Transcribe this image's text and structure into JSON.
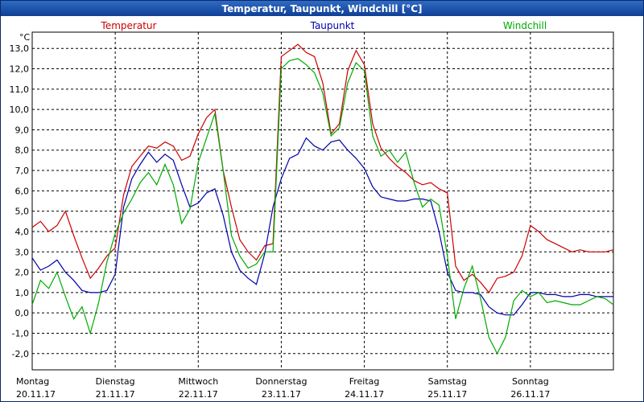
{
  "window": {
    "title": "Temperatur, Taupunkt, Windchill [°C]"
  },
  "chart_data": {
    "type": "line",
    "title": "Temperatur, Taupunkt, Windchill [°C]",
    "ylabel": "°C",
    "ylim": [
      -2.8,
      13.8
    ],
    "yticks": [
      -2,
      -1,
      0,
      1,
      2,
      3,
      4,
      5,
      6,
      7,
      8,
      9,
      10,
      11,
      12,
      13
    ],
    "ytick_labels": [
      "-2,0",
      "-1,0",
      "0,0",
      "1,0",
      "2,0",
      "3,0",
      "4,0",
      "5,0",
      "6,0",
      "7,0",
      "8,0",
      "9,0",
      "10,0",
      "11,0",
      "12,0",
      "13,0"
    ],
    "xlim": [
      0,
      7.0
    ],
    "grid": true,
    "x_label_days": [
      {
        "pos": 0,
        "day": "Montag",
        "date": "20.11.17"
      },
      {
        "pos": 1,
        "day": "Dienstag",
        "date": "21.11.17"
      },
      {
        "pos": 2,
        "day": "Mittwoch",
        "date": "22.11.17"
      },
      {
        "pos": 3,
        "day": "Donnerstag",
        "date": "23.11.17"
      },
      {
        "pos": 4,
        "day": "Freitag",
        "date": "24.11.17"
      },
      {
        "pos": 5,
        "day": "Samstag",
        "date": "25.11.17"
      },
      {
        "pos": 6,
        "day": "Sonntag",
        "date": "26.11.17"
      }
    ],
    "series": [
      {
        "name": "Temperatur",
        "color": "#cc0000",
        "x": [
          0,
          0.1,
          0.2,
          0.3,
          0.4,
          0.5,
          0.6,
          0.7,
          0.8,
          0.9,
          1.0,
          1.1,
          1.2,
          1.3,
          1.4,
          1.5,
          1.6,
          1.7,
          1.8,
          1.9,
          2.0,
          2.1,
          2.2,
          2.3,
          2.4,
          2.5,
          2.6,
          2.7,
          2.8,
          2.9,
          3.0,
          3.1,
          3.2,
          3.3,
          3.4,
          3.5,
          3.6,
          3.7,
          3.8,
          3.9,
          4.0,
          4.1,
          4.2,
          4.3,
          4.4,
          4.5,
          4.6,
          4.7,
          4.8,
          4.9,
          5.0,
          5.1,
          5.2,
          5.3,
          5.4,
          5.5,
          5.6,
          5.7,
          5.8,
          5.9,
          6.0,
          6.1,
          6.2,
          6.3,
          6.4,
          6.5,
          6.6,
          6.7,
          6.8,
          6.9,
          7.0
        ],
        "values": [
          4.2,
          4.5,
          4.0,
          4.3,
          5.0,
          3.8,
          2.7,
          1.7,
          2.2,
          2.8,
          3.2,
          5.8,
          7.2,
          7.7,
          8.2,
          8.1,
          8.4,
          8.2,
          7.5,
          7.7,
          8.8,
          9.6,
          10.0,
          7.0,
          5.2,
          3.6,
          3.0,
          2.6,
          3.3,
          3.4,
          12.6,
          12.9,
          13.2,
          12.8,
          12.6,
          11.3,
          8.8,
          9.3,
          11.9,
          12.9,
          12.2,
          9.3,
          8.1,
          7.6,
          7.2,
          6.9,
          6.5,
          6.3,
          6.4,
          6.1,
          5.9,
          2.3,
          1.6,
          1.9,
          1.5,
          1.0,
          1.7,
          1.8,
          2.0,
          2.8,
          4.3,
          4.0,
          3.6,
          3.4,
          3.2,
          3.0,
          3.1,
          3.0,
          3.0,
          3.0,
          3.1
        ]
      },
      {
        "name": "Taupunkt",
        "color": "#0000aa",
        "x": [
          0,
          0.1,
          0.2,
          0.3,
          0.4,
          0.5,
          0.6,
          0.7,
          0.8,
          0.9,
          1.0,
          1.1,
          1.2,
          1.3,
          1.4,
          1.5,
          1.6,
          1.7,
          1.8,
          1.9,
          2.0,
          2.1,
          2.2,
          2.3,
          2.4,
          2.5,
          2.6,
          2.7,
          2.8,
          2.9,
          3.0,
          3.1,
          3.2,
          3.3,
          3.4,
          3.5,
          3.6,
          3.7,
          3.8,
          3.9,
          4.0,
          4.1,
          4.2,
          4.3,
          4.4,
          4.5,
          4.6,
          4.7,
          4.8,
          4.9,
          5.0,
          5.1,
          5.2,
          5.3,
          5.4,
          5.5,
          5.6,
          5.7,
          5.8,
          5.9,
          6.0,
          6.1,
          6.2,
          6.3,
          6.4,
          6.5,
          6.6,
          6.7,
          6.8,
          6.9,
          7.0
        ],
        "values": [
          2.7,
          2.1,
          2.3,
          2.6,
          2.0,
          1.6,
          1.1,
          1.0,
          1.0,
          1.1,
          1.9,
          5.2,
          6.6,
          7.3,
          7.9,
          7.4,
          7.8,
          7.5,
          6.3,
          5.2,
          5.4,
          5.9,
          6.1,
          4.8,
          3.0,
          2.1,
          1.7,
          1.4,
          2.9,
          5.2,
          6.6,
          7.6,
          7.8,
          8.6,
          8.2,
          8.0,
          8.4,
          8.5,
          8.0,
          7.6,
          7.1,
          6.2,
          5.7,
          5.6,
          5.5,
          5.5,
          5.6,
          5.6,
          5.5,
          4.0,
          2.0,
          1.1,
          1.0,
          1.0,
          0.9,
          0.3,
          0.0,
          -0.1,
          -0.1,
          0.4,
          1.0,
          1.0,
          0.9,
          0.9,
          0.8,
          0.8,
          0.9,
          0.9,
          0.8,
          0.8,
          0.8
        ]
      },
      {
        "name": "Windchill",
        "color": "#00aa00",
        "x": [
          0,
          0.1,
          0.2,
          0.3,
          0.4,
          0.5,
          0.6,
          0.7,
          0.8,
          0.9,
          1.0,
          1.1,
          1.2,
          1.3,
          1.4,
          1.5,
          1.6,
          1.7,
          1.8,
          1.9,
          2.0,
          2.1,
          2.2,
          2.3,
          2.4,
          2.5,
          2.6,
          2.7,
          2.8,
          2.9,
          3.0,
          3.1,
          3.2,
          3.3,
          3.4,
          3.5,
          3.6,
          3.7,
          3.8,
          3.9,
          4.0,
          4.1,
          4.2,
          4.3,
          4.4,
          4.5,
          4.6,
          4.7,
          4.8,
          4.9,
          5.0,
          5.1,
          5.2,
          5.3,
          5.4,
          5.5,
          5.6,
          5.7,
          5.8,
          5.9,
          6.0,
          6.1,
          6.2,
          6.3,
          6.4,
          6.5,
          6.6,
          6.7,
          6.8,
          6.9,
          7.0
        ],
        "values": [
          0.4,
          1.6,
          1.2,
          2.0,
          0.8,
          -0.3,
          0.3,
          -1.0,
          0.5,
          2.5,
          3.9,
          4.9,
          5.6,
          6.4,
          6.9,
          6.3,
          7.3,
          6.3,
          4.4,
          5.1,
          7.4,
          8.6,
          9.8,
          7.0,
          3.8,
          2.8,
          2.2,
          2.4,
          3.0,
          3.0,
          12.0,
          12.4,
          12.5,
          12.2,
          11.8,
          10.8,
          8.7,
          9.1,
          11.3,
          12.3,
          11.9,
          8.7,
          7.7,
          8.0,
          7.4,
          7.9,
          6.4,
          5.2,
          5.6,
          5.3,
          2.8,
          -0.3,
          1.2,
          2.3,
          0.7,
          -1.2,
          -2.0,
          -1.2,
          0.6,
          1.1,
          0.8,
          1.0,
          0.5,
          0.6,
          0.5,
          0.4,
          0.4,
          0.6,
          0.8,
          0.7,
          0.4
        ]
      }
    ]
  }
}
